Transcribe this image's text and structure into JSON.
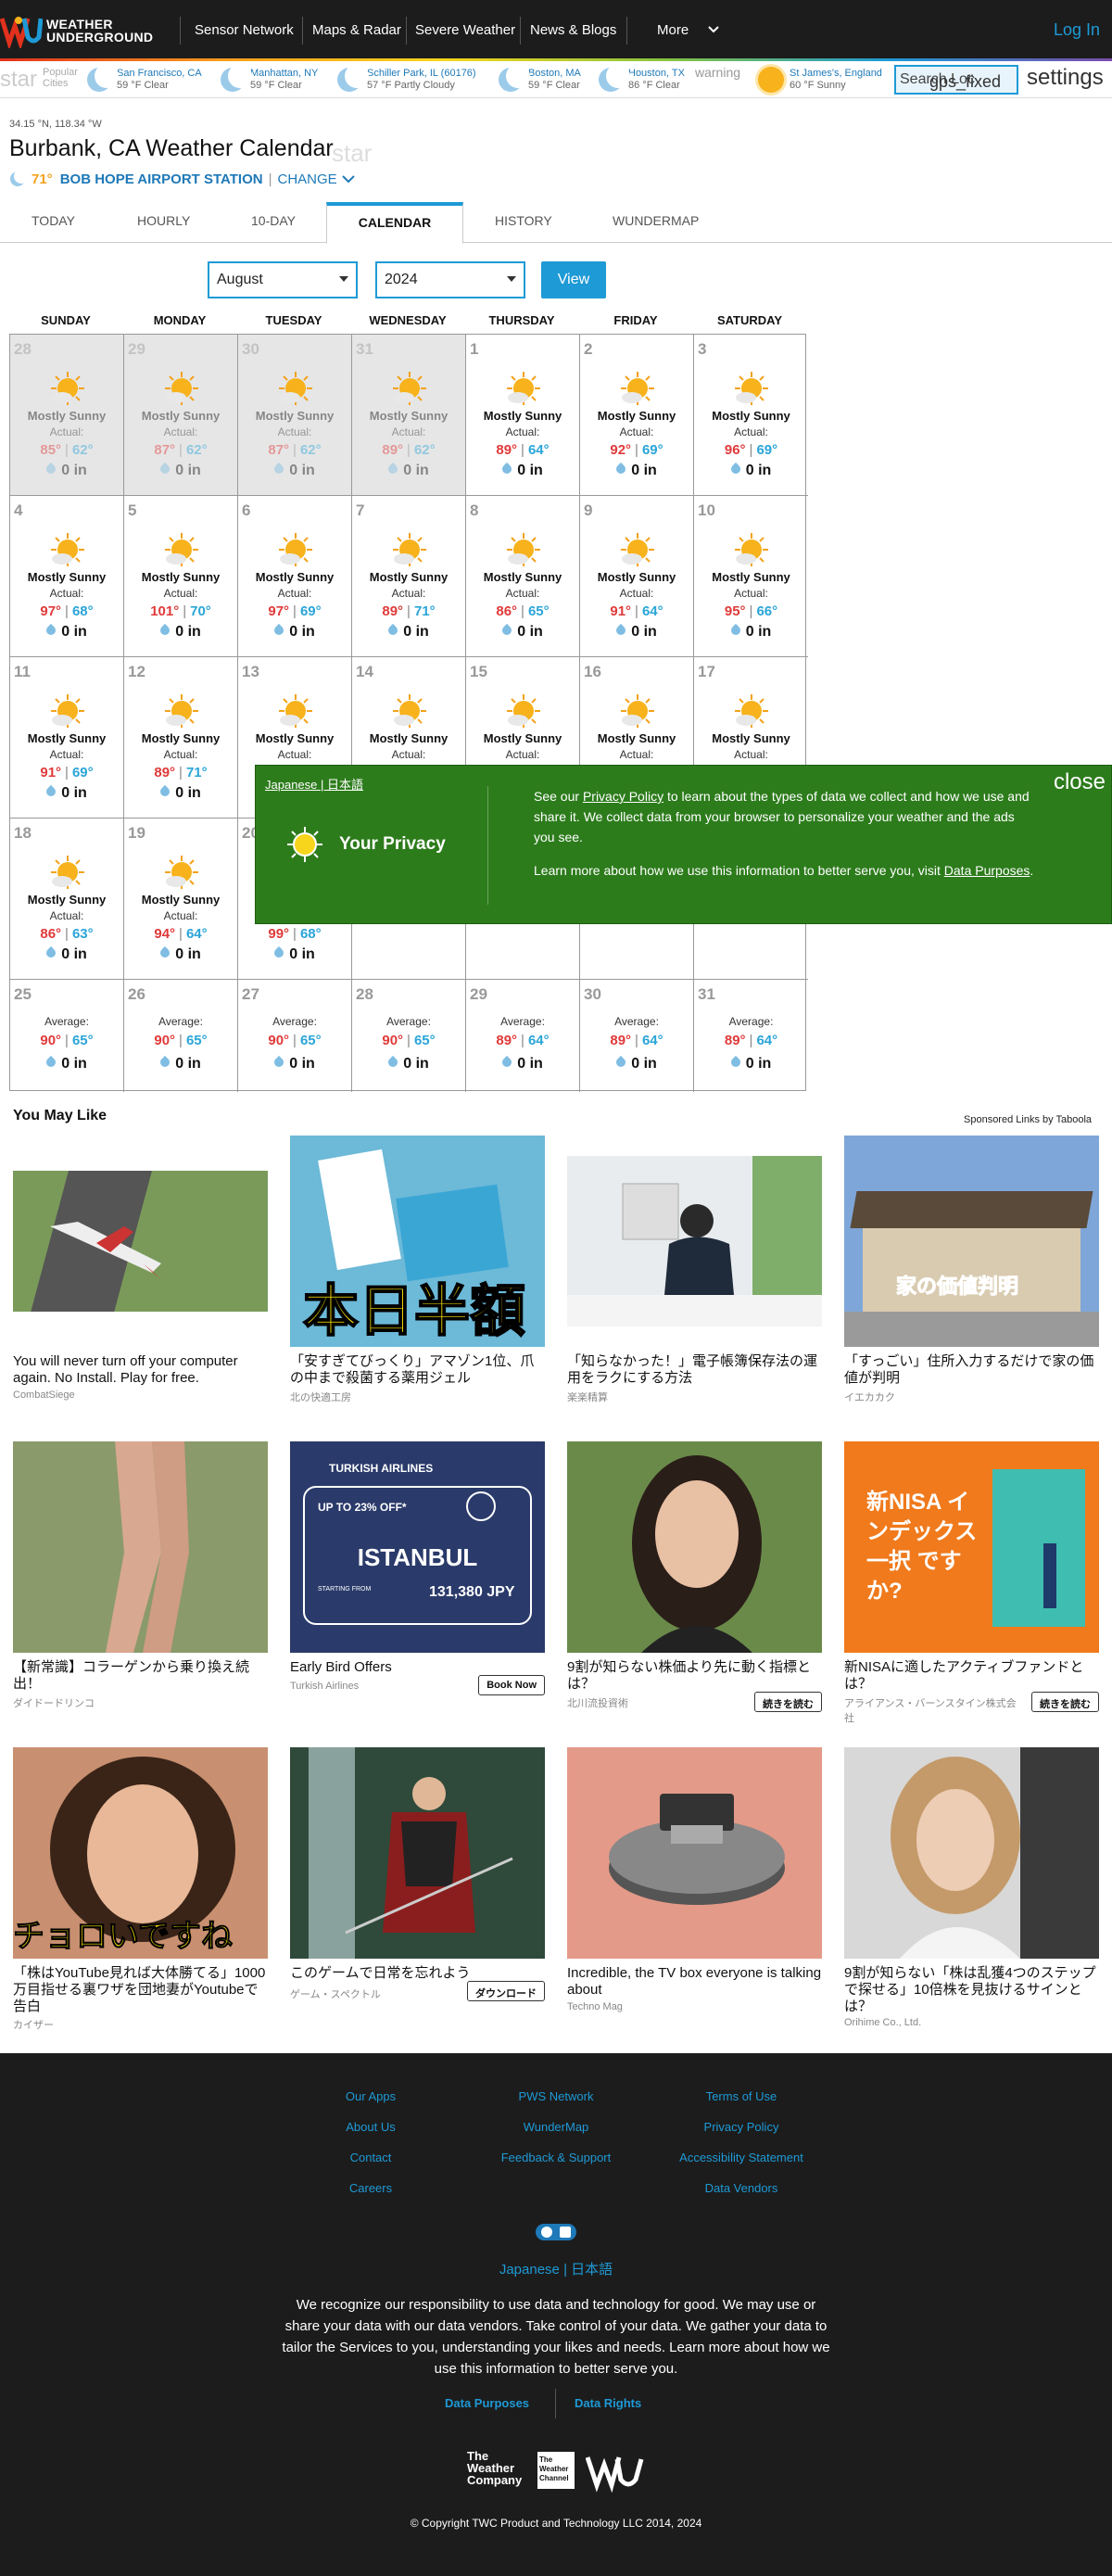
{
  "nav": {
    "logo_line1": "WEATHER",
    "logo_line2": "UNDERGROUND",
    "links": [
      "Sensor Network",
      "Maps & Radar",
      "Severe Weather",
      "News & Blogs",
      "More"
    ],
    "login": "Log In"
  },
  "favorites": {
    "ghost_star": "star",
    "popular_label": "Popular Cities",
    "items": [
      {
        "city": "San Francisco, CA",
        "temp": "59 °F Clear",
        "icon": "moon-icon"
      },
      {
        "city": "Manhattan, NY",
        "temp": "59 °F Clear",
        "icon": "moon-icon"
      },
      {
        "city": "Schiller Park, IL (60176)",
        "temp": "57 °F Partly Cloudy",
        "icon": "moon-icon"
      },
      {
        "city": "Boston, MA",
        "temp": "59 °F Clear",
        "icon": "moon-icon"
      },
      {
        "city": "Houston, TX",
        "temp": "86 °F Clear",
        "icon": "moon-icon"
      },
      {
        "city": "St James's, England",
        "temp": "60 °F Sunny",
        "icon": "sun-icon"
      }
    ],
    "warning_label": "warning",
    "search_value": "Search Loc",
    "search_overlay": "gps_fixed",
    "settings_label": "settings"
  },
  "location": {
    "coords": "34.15 °N, 118.34 °W",
    "city_title": "Burbank, CA Weather Calendar",
    "ghost_star": "star",
    "station_temp": "71°",
    "station_name": "BOB HOPE AIRPORT STATION",
    "separator": "|",
    "change_label": "CHANGE"
  },
  "tabs": [
    "TODAY",
    "HOURLY",
    "10-DAY",
    "CALENDAR",
    "HISTORY",
    "WUNDERMAP"
  ],
  "active_tab": "CALENDAR",
  "selectors": {
    "month": "August",
    "year": "2024",
    "view_label": "View"
  },
  "calendar": {
    "weekdays": [
      "SUNDAY",
      "MONDAY",
      "TUESDAY",
      "WEDNESDAY",
      "THURSDAY",
      "FRIDAY",
      "SATURDAY"
    ],
    "weeks": [
      [
        {
          "day": "28",
          "past": true,
          "cond": "Mostly Sunny",
          "label": "Actual:",
          "hi": "85°",
          "lo": "62°",
          "precip": "0 in"
        },
        {
          "day": "29",
          "past": true,
          "cond": "Mostly Sunny",
          "label": "Actual:",
          "hi": "87°",
          "lo": "62°",
          "precip": "0 in"
        },
        {
          "day": "30",
          "past": true,
          "cond": "Mostly Sunny",
          "label": "Actual:",
          "hi": "87°",
          "lo": "62°",
          "precip": "0 in"
        },
        {
          "day": "31",
          "past": true,
          "cond": "Mostly Sunny",
          "label": "Actual:",
          "hi": "89°",
          "lo": "62°",
          "precip": "0 in"
        },
        {
          "day": "1",
          "cond": "Mostly Sunny",
          "label": "Actual:",
          "hi": "89°",
          "lo": "64°",
          "precip": "0 in"
        },
        {
          "day": "2",
          "cond": "Mostly Sunny",
          "label": "Actual:",
          "hi": "92°",
          "lo": "69°",
          "precip": "0 in"
        },
        {
          "day": "3",
          "cond": "Mostly Sunny",
          "label": "Actual:",
          "hi": "96°",
          "lo": "69°",
          "precip": "0 in"
        }
      ],
      [
        {
          "day": "4",
          "cond": "Mostly Sunny",
          "label": "Actual:",
          "hi": "97°",
          "lo": "68°",
          "precip": "0 in"
        },
        {
          "day": "5",
          "cond": "Mostly Sunny",
          "label": "Actual:",
          "hi": "101°",
          "lo": "70°",
          "precip": "0 in"
        },
        {
          "day": "6",
          "cond": "Mostly Sunny",
          "label": "Actual:",
          "hi": "97°",
          "lo": "69°",
          "precip": "0 in"
        },
        {
          "day": "7",
          "cond": "Mostly Sunny",
          "label": "Actual:",
          "hi": "89°",
          "lo": "71°",
          "precip": "0 in"
        },
        {
          "day": "8",
          "cond": "Mostly Sunny",
          "label": "Actual:",
          "hi": "86°",
          "lo": "65°",
          "precip": "0 in"
        },
        {
          "day": "9",
          "cond": "Mostly Sunny",
          "label": "Actual:",
          "hi": "91°",
          "lo": "64°",
          "precip": "0 in"
        },
        {
          "day": "10",
          "cond": "Mostly Sunny",
          "label": "Actual:",
          "hi": "95°",
          "lo": "66°",
          "precip": "0 in"
        }
      ],
      [
        {
          "day": "11",
          "cond": "Mostly Sunny",
          "label": "Actual:",
          "hi": "91°",
          "lo": "69°",
          "precip": "0 in"
        },
        {
          "day": "12",
          "cond": "Mostly Sunny",
          "label": "Actual:",
          "hi": "89°",
          "lo": "71°",
          "precip": "0 in"
        },
        {
          "day": "13",
          "cond": "Mostly Sunny",
          "label": "Actual:",
          "hi": "",
          "lo": "",
          "precip": ""
        },
        {
          "day": "14",
          "cond": "Mostly Sunny",
          "label": "Actual:",
          "hi": "",
          "lo": "",
          "precip": ""
        },
        {
          "day": "15",
          "cond": "Mostly Sunny",
          "label": "Actual:",
          "hi": "",
          "lo": "",
          "precip": ""
        },
        {
          "day": "16",
          "cond": "Mostly Sunny",
          "label": "Actual:",
          "hi": "",
          "lo": "",
          "precip": ""
        },
        {
          "day": "17",
          "cond": "Mostly Sunny",
          "label": "Actual:",
          "hi": "",
          "lo": "",
          "precip": ""
        }
      ],
      [
        {
          "day": "18",
          "cond": "Mostly Sunny",
          "label": "Actual:",
          "hi": "86°",
          "lo": "63°",
          "precip": "0 in"
        },
        {
          "day": "19",
          "cond": "Mostly Sunny",
          "label": "Actual:",
          "hi": "94°",
          "lo": "64°",
          "precip": "0 in"
        },
        {
          "day": "20",
          "cond": "",
          "label": "",
          "hi": "99°",
          "lo": "68°",
          "precip": "0 in"
        },
        {
          "day": "",
          "cond": "",
          "label": "",
          "hi": "",
          "lo": "",
          "precip": ""
        },
        {
          "day": "",
          "cond": "",
          "label": "",
          "hi": "",
          "lo": "",
          "precip": ""
        },
        {
          "day": "",
          "cond": "",
          "label": "",
          "hi": "",
          "lo": "",
          "precip": ""
        },
        {
          "day": "",
          "cond": "",
          "label": "",
          "hi": "",
          "lo": "",
          "precip": ""
        }
      ],
      [
        {
          "day": "25",
          "avg": true,
          "label": "Average:",
          "hi": "90°",
          "lo": "65°",
          "precip": "0 in"
        },
        {
          "day": "26",
          "avg": true,
          "label": "Average:",
          "hi": "90°",
          "lo": "65°",
          "precip": "0 in"
        },
        {
          "day": "27",
          "avg": true,
          "label": "Average:",
          "hi": "90°",
          "lo": "65°",
          "precip": "0 in"
        },
        {
          "day": "28",
          "avg": true,
          "label": "Average:",
          "hi": "90°",
          "lo": "65°",
          "precip": "0 in"
        },
        {
          "day": "29",
          "avg": true,
          "label": "Average:",
          "hi": "89°",
          "lo": "64°",
          "precip": "0 in"
        },
        {
          "day": "30",
          "avg": true,
          "label": "Average:",
          "hi": "89°",
          "lo": "64°",
          "precip": "0 in"
        },
        {
          "day": "31",
          "avg": true,
          "label": "Average:",
          "hi": "89°",
          "lo": "64°",
          "precip": "0 in"
        }
      ]
    ]
  },
  "privacy": {
    "lang_link": "Japanese | 日本語",
    "close_label": "close",
    "title": "Your Privacy",
    "p1_pre": "See our ",
    "p1_link": "Privacy Policy",
    "p1_post": " to learn about the types of data we collect and how we use and share it. We collect data from your browser to personalize your weather and the ads you see.",
    "p2_pre": "Learn more about how we use this information to better serve you, visit ",
    "p2_link": "Data Purposes",
    "p2_post": "."
  },
  "you_may_like": {
    "heading": "You May Like",
    "sponsored": "Sponsored Links by Taboola",
    "cards": [
      {
        "title": "You will never turn off your computer again. No Install. Play for free.",
        "source": "CombatSiege",
        "button": "",
        "overlay": ""
      },
      {
        "title": "「安すぎてびっくり」アマゾン1位、爪の中まで殺菌する薬用ジェル",
        "source": "北の快適工房",
        "button": "",
        "overlay": "本日半額"
      },
      {
        "title": "「知らなかった！」電子帳簿保存法の運用をラクにする方法",
        "source": "楽楽精算",
        "button": "",
        "overlay": ""
      },
      {
        "title": "「すっごい」住所入力するだけで家の価値が判明",
        "source": "イエカカク",
        "button": "",
        "overlay": "家の価値判明"
      },
      {
        "title": "【新常識】コラーゲンから乗り換え続出！",
        "source": "ダイドードリンコ",
        "button": "",
        "overlay": ""
      },
      {
        "title": "Early Bird Offers",
        "source": "Turkish Airlines",
        "button": "Book Now",
        "overlay": "ISTANBUL"
      },
      {
        "title": "9割が知らない株価より先に動く指標とは？",
        "source": "北川流投資術",
        "button": "続きを読む",
        "overlay": ""
      },
      {
        "title": "新NISAに適したアクティブファンドとは？",
        "source": "アライアンス・バーンスタイン株式会社",
        "button": "続きを読む",
        "overlay": "新NISA インデックス 一択 ですか?"
      },
      {
        "title": "「株はYouTube見れば大体勝てる」1000万目指せる裏ワザを団地妻がYoutubeで告白",
        "source": "カイザー",
        "button": "",
        "overlay": "チョロいですね"
      },
      {
        "title": "このゲームで日常を忘れよう",
        "source": "ゲーム・スペクトル",
        "button": "ダウンロード",
        "overlay": ""
      },
      {
        "title": "Incredible, the TV box everyone is talking about",
        "source": "Techno Mag",
        "button": "",
        "overlay": ""
      },
      {
        "title": "9割が知らない「株は乱獲4つのステップで探せる」10倍株を見抜けるサインとは？",
        "source": "Orihime Co., Ltd.",
        "button": "",
        "overlay": ""
      }
    ],
    "ad_texts": {
      "airline": "TURKISH AIRLINES",
      "offer": "UP TO 23% OFF*",
      "price": "131,380 JPY",
      "starting": "STARTING FROM"
    }
  },
  "footer": {
    "col1": [
      "Our Apps",
      "About Us",
      "Contact",
      "Careers"
    ],
    "col2": [
      "PWS Network",
      "WunderMap",
      "Feedback & Support"
    ],
    "col3": [
      "Terms of Use",
      "Privacy Policy",
      "Accessibility Statement",
      "Data Vendors"
    ],
    "lang": "Japanese | 日本語",
    "text": "We recognize our responsibility to use data and technology for good. We may use or share your data with our data vendors. Take control of your data. We gather your data to tailor the Services to you, understanding your likes and needs. Learn more about how we use this information to better serve you.",
    "data_purposes": "Data Purposes",
    "data_rights": "Data Rights",
    "logo1": "The Weather Company",
    "logo2": "The Weather Channel",
    "copyright": "© Copyright TWC Product and Technology LLC 2014, 2024"
  },
  "colors": {
    "accent": "#1e9ad6",
    "nav_bg": "#1c1c1c",
    "hi": "#e03a3a",
    "lo": "#2aa5d8",
    "privacy_bg": "#2d7c1c"
  }
}
